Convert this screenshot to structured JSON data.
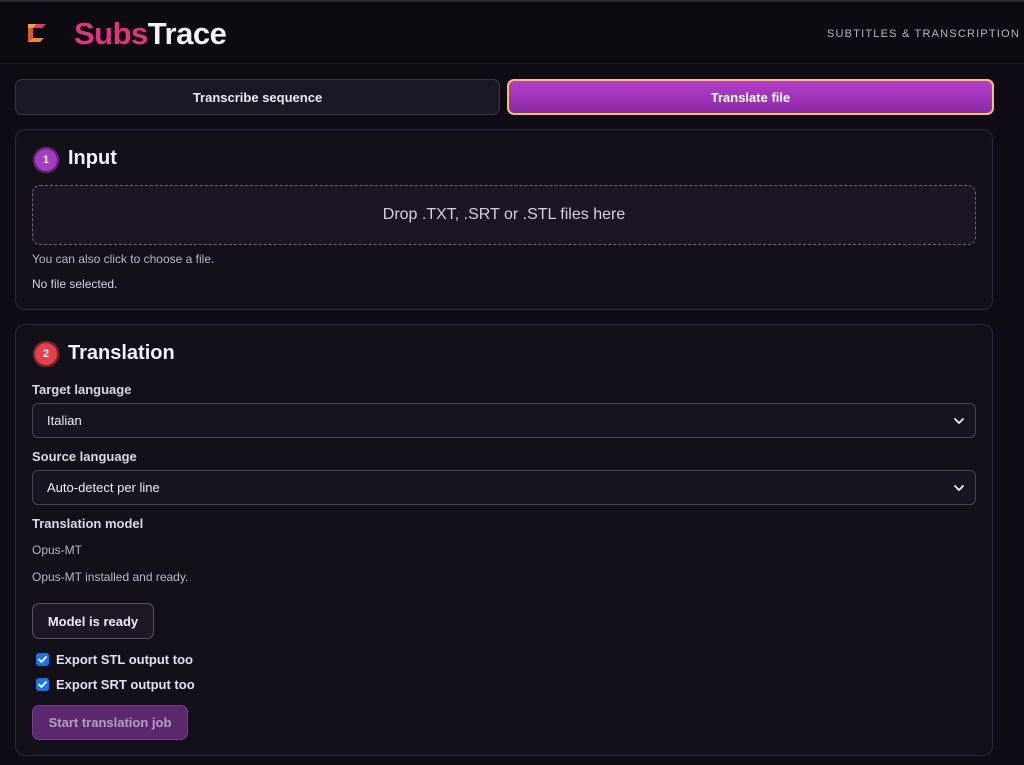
{
  "header": {
    "brand_part1": "Subs",
    "brand_part2": "Trace",
    "tagline": "SUBTITLES & TRANSCRIPTION",
    "logo_icon": "logo-icon"
  },
  "tabs": [
    {
      "label": "Transcribe sequence",
      "active": false
    },
    {
      "label": "Translate file",
      "active": true
    }
  ],
  "input_section": {
    "step": "1",
    "title": "Input",
    "dropzone_text": "Drop .TXT, .SRT or .STL files here",
    "hint": "You can also click to choose a file.",
    "file_status": "No file selected."
  },
  "translation_section": {
    "step": "2",
    "title": "Translation",
    "target_language": {
      "label": "Target language",
      "value": "Italian"
    },
    "source_language": {
      "label": "Source language",
      "value": "Auto-detect per line"
    },
    "model": {
      "label": "Translation model",
      "name": "Opus-MT",
      "status": "Opus-MT installed and ready."
    },
    "model_button": "Model is ready",
    "export_stl": {
      "label": "Export STL output too",
      "checked": true
    },
    "export_srt": {
      "label": "Export SRT output too",
      "checked": true
    },
    "start_button": "Start translation job"
  },
  "colors": {
    "accent": "#a63bc4",
    "brand_pink": "#e0357e",
    "active_tab_border": "#f0c46a",
    "step2": "#e3414d",
    "checkbox": "#1a73e8"
  }
}
